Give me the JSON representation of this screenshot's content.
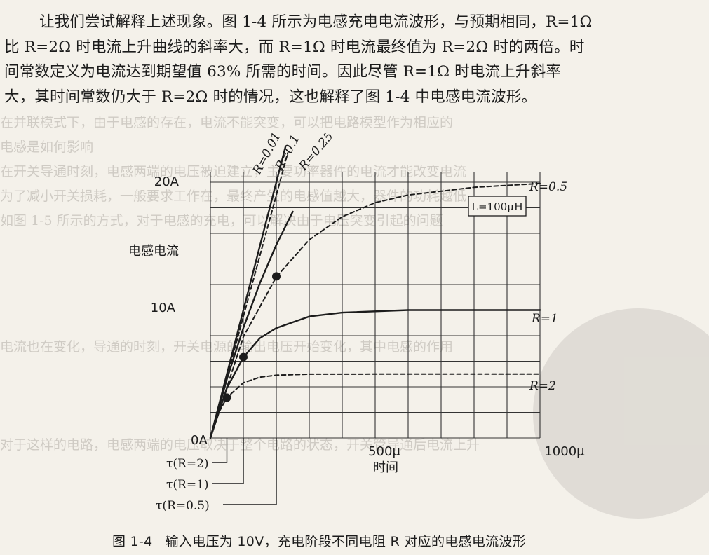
{
  "paragraph": {
    "lines": [
      "让我们尝试解释上述现象。图 1-4 所示为电感充电电流波形，与预期相同，R=1Ω",
      "比 R=2Ω 时电流上升曲线的斜率大，而 R=1Ω 时电流最终值为 R=2Ω 时的两倍。时",
      "间常数定义为电流达到期望值 63% 所需的时间。因此尽管 R=1Ω 时电流上升斜率",
      "大，其时间常数仍大于 R=2Ω 时的情况，这也解释了图 1-4 中电感电流波形。"
    ]
  },
  "figure": {
    "ylabel": "电感电流",
    "xlabel": "时间",
    "y_ticks": [
      "20A",
      "10A",
      "0A"
    ],
    "x_ticks": [
      "500μ",
      "1000μ"
    ],
    "inductor_label": "L=100μH",
    "curve_labels": {
      "r001": "R=0.01",
      "r01": "R=0.1",
      "r025": "R=0.25",
      "r05": "R=0.5",
      "r1": "R=1",
      "r2": "R=2"
    },
    "tau_labels": [
      "τ(R=2)",
      "τ(R=1)",
      "τ(R=0.5)"
    ]
  },
  "chart_data": {
    "type": "line",
    "xlabel": "时间",
    "ylabel": "电感电流",
    "xlim": [
      0,
      1000
    ],
    "ylim": [
      0,
      20
    ],
    "x_unit": "μs",
    "y_unit": "A",
    "grid": true,
    "series": [
      {
        "name": "R=0.01",
        "x": [
          0,
          228
        ],
        "y": [
          0,
          22.8
        ]
      },
      {
        "name": "R=0.1",
        "x": [
          0,
          235
        ],
        "y": [
          0,
          22.3
        ]
      },
      {
        "name": "R=0.25",
        "x": [
          0,
          50,
          100,
          150,
          200,
          250
        ],
        "y": [
          0,
          4.6,
          8.6,
          12.1,
          15.1,
          17.7
        ]
      },
      {
        "name": "R=0.5",
        "x": [
          0,
          100,
          200,
          300,
          400,
          500,
          600,
          800,
          1000
        ],
        "y": [
          0,
          7.9,
          12.6,
          15.5,
          17.3,
          18.4,
          19.0,
          19.6,
          19.9
        ]
      },
      {
        "name": "R=1",
        "x": [
          0,
          50,
          100,
          150,
          200,
          300,
          400,
          600,
          800,
          1000
        ],
        "y": [
          0,
          3.9,
          6.3,
          7.8,
          8.6,
          9.5,
          9.8,
          10.0,
          10.0,
          10.0
        ]
      },
      {
        "name": "R=2",
        "x": [
          0,
          25,
          50,
          100,
          150,
          200,
          300,
          500,
          1000
        ],
        "y": [
          0,
          1.97,
          3.16,
          4.32,
          4.75,
          4.91,
          4.99,
          5.0,
          5.0
        ]
      }
    ],
    "time_constants": [
      {
        "label": "τ(R=2)",
        "x": 50,
        "y": 3.16
      },
      {
        "label": "τ(R=1)",
        "x": 100,
        "y": 6.32
      },
      {
        "label": "τ(R=0.5)",
        "x": 200,
        "y": 12.64
      }
    ]
  },
  "caption": {
    "number": "图 1-4",
    "text": "输入电压为 10V，充电阶段不同电阻 R 对应的电感电流波形"
  },
  "bleed": {
    "line1": "在并联模式下，由于电感的存在，电流不能突变，可以把电路模型作为相应的",
    "line2": "电感是如何影响",
    "line3": "在开关导通时刻，电感两端的电压被迫建立，主要功率器件的电流才能改变电流",
    "line4": "为了减小开关损耗，一般要求工作在，最终产生的电感值越大，器件的功耗越低",
    "line5": "如图 1-5 所示的方式，对于电感的充电，可以解决由于电压突变引起的问题",
    "line6": "电流也在变化，导通的时刻，开关电源的输出电压开始变化，其中电感的作用",
    "line7": "对于这样的电路，电感两端的电压取决于整个电路的状态，开关管导通后电流上升"
  }
}
